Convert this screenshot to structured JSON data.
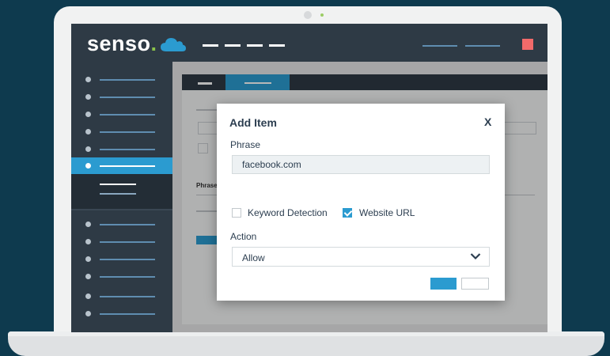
{
  "brand": {
    "name": "senso",
    "dot": ".",
    "accent": "#2b9bd0",
    "dot_color": "#8bc34a",
    "stop_color": "#f26a6a",
    "logo_icon": "cloud-icon"
  },
  "background_form": {
    "column_header": "Phrase"
  },
  "modal": {
    "title": "Add Item",
    "close_label": "X",
    "phrase_label": "Phrase",
    "phrase_value": "facebook.com",
    "options": [
      {
        "label": "Keyword Detection",
        "checked": false
      },
      {
        "label": "Website URL",
        "checked": true
      }
    ],
    "action_label": "Action",
    "action_value": "Allow",
    "action_icon": "chevron-down-icon"
  }
}
